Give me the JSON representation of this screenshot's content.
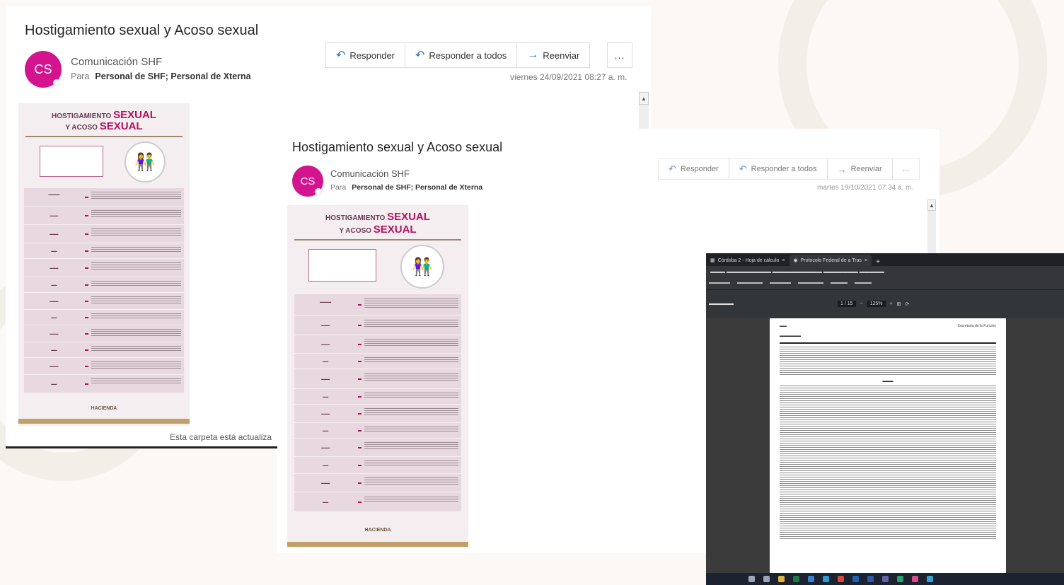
{
  "email_1": {
    "subject": "Hostigamiento sexual y Acoso sexual",
    "avatar_initials": "CS",
    "sender": "Comunicación SHF",
    "to_label": "Para",
    "recipients": "Personal de SHF; Personal de Xterna",
    "date": "viernes 24/09/2021 08:27 a. m.",
    "actions": {
      "reply": "Responder",
      "reply_all": "Responder a todos",
      "forward": "Reenviar",
      "more": "..."
    },
    "status": "Esta carpeta está actualiza"
  },
  "email_2": {
    "subject": "Hostigamiento sexual y Acoso sexual",
    "avatar_initials": "CS",
    "sender": "Comunicación SHF",
    "to_label": "Para",
    "recipients": "Personal de SHF; Personal de Xterna",
    "date": "martes 19/10/2021 07:34 a. m.",
    "actions": {
      "reply": "Responder",
      "reply_all": "Responder a todos",
      "forward": "Reenviar",
      "more": "..."
    }
  },
  "poster": {
    "line1_prefix": "HOSTIGAMIENTO",
    "line1_highlight": "SEXUAL",
    "line2_prefix": "Y ACOSO",
    "line2_highlight": "SEXUAL",
    "footer_logo": "HACIENDA"
  },
  "browser": {
    "tabs": [
      "Córdoba 2 - Hoja de cálculo",
      "Protocolo Federal de a Tras"
    ],
    "new_tab": "+",
    "page_indicator": "1 / 15",
    "zoom": "125%",
    "page_header_right": "Secretaría de la Función"
  },
  "colors": {
    "accent": "#d4148f",
    "poster_magenta": "#b3125f",
    "outlook_blue": "#2a6bb5",
    "gold": "#bfa06a"
  }
}
